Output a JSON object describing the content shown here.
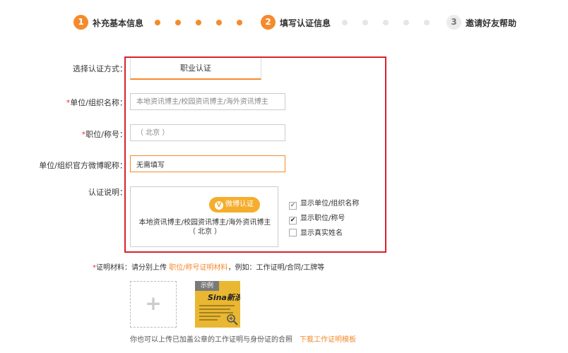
{
  "steps": [
    {
      "num": "1",
      "label": "补充基本信息"
    },
    {
      "num": "2",
      "label": "填写认证信息"
    },
    {
      "num": "3",
      "label": "邀请好友帮助"
    }
  ],
  "form": {
    "auth_method_label": "选择认证方式：",
    "auth_method_tab": "职业认证",
    "org_name_label": "单位/组织名称：",
    "org_name_required": "*",
    "org_name_placeholder": "本地资讯博主/校园资讯博主/海外资讯博主",
    "position_label": "职位/称号：",
    "position_required": "*",
    "position_placeholder": "（ 北京 ）",
    "weibo_nick_label": "单位/组织官方微博昵称：",
    "weibo_nick_value": "无需填写",
    "desc_label": "认证说明：",
    "weibo_badge_icon": "V",
    "weibo_badge_text": "微博认证",
    "desc_text": "本地资讯博主/校园资讯博主/海外资讯博主 （ 北京 ）",
    "options": [
      {
        "label": "显示单位/组织名称",
        "checked": true,
        "style": "grey"
      },
      {
        "label": "显示职位/称号",
        "checked": true,
        "style": "dark"
      },
      {
        "label": "显示真实姓名",
        "checked": false,
        "style": "none"
      }
    ],
    "proof_required": "*",
    "proof_label": "证明材料：",
    "proof_text_before": "请分别上传 ",
    "proof_link": "职位/称号证明材料",
    "proof_text_after": "，例如：工作证明/合同/工牌等",
    "upload_plus": "+",
    "sample_tag": "示例",
    "sample_logo": "Sina新浪",
    "bottom_note": "你也可以上传已加盖公章的工作证明与身份证的合照",
    "download_link": "下载工作证明模板"
  },
  "colors": {
    "accent": "#f58a2d",
    "highlight_border": "#d8222a"
  }
}
